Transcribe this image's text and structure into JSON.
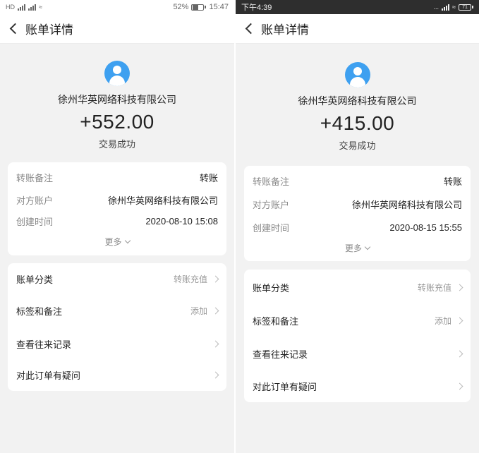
{
  "left": {
    "status_bar": {
      "carrier": "HD",
      "percent": "52%",
      "time": "15:47"
    },
    "nav": {
      "title": "账单详情"
    },
    "company": "徐州华英网络科技有限公司",
    "amount": "+552.00",
    "status": "交易成功",
    "details": [
      {
        "key": "转账备注",
        "value": "转账"
      },
      {
        "key": "对方账户",
        "value": "徐州华英网络科技有限公司"
      },
      {
        "key": "创建时间",
        "value": "2020-08-10 15:08"
      }
    ],
    "more": "更多",
    "menu": [
      {
        "label": "账单分类",
        "value": "转账充值"
      },
      {
        "label": "标签和备注",
        "value": "添加"
      },
      {
        "label": "查看往来记录",
        "value": ""
      },
      {
        "label": "对此订单有疑问",
        "value": ""
      }
    ]
  },
  "right": {
    "status_bar": {
      "time": "下午4:39",
      "dots": "...",
      "battery": "71"
    },
    "nav": {
      "title": "账单详情"
    },
    "company": "徐州华英网络科技有限公司",
    "amount": "+415.00",
    "status": "交易成功",
    "details": [
      {
        "key": "转账备注",
        "value": "转账"
      },
      {
        "key": "对方账户",
        "value": "徐州华英网络科技有限公司"
      },
      {
        "key": "创建时间",
        "value": "2020-08-15 15:55"
      }
    ],
    "more": "更多",
    "menu": [
      {
        "label": "账单分类",
        "value": "转账充值"
      },
      {
        "label": "标签和备注",
        "value": "添加"
      },
      {
        "label": "查看往来记录",
        "value": ""
      },
      {
        "label": "对此订单有疑问",
        "value": ""
      }
    ]
  },
  "colors": {
    "avatar": "#3ea0f0",
    "page_bg": "#f2f2f2",
    "card_bg": "#ffffff"
  }
}
